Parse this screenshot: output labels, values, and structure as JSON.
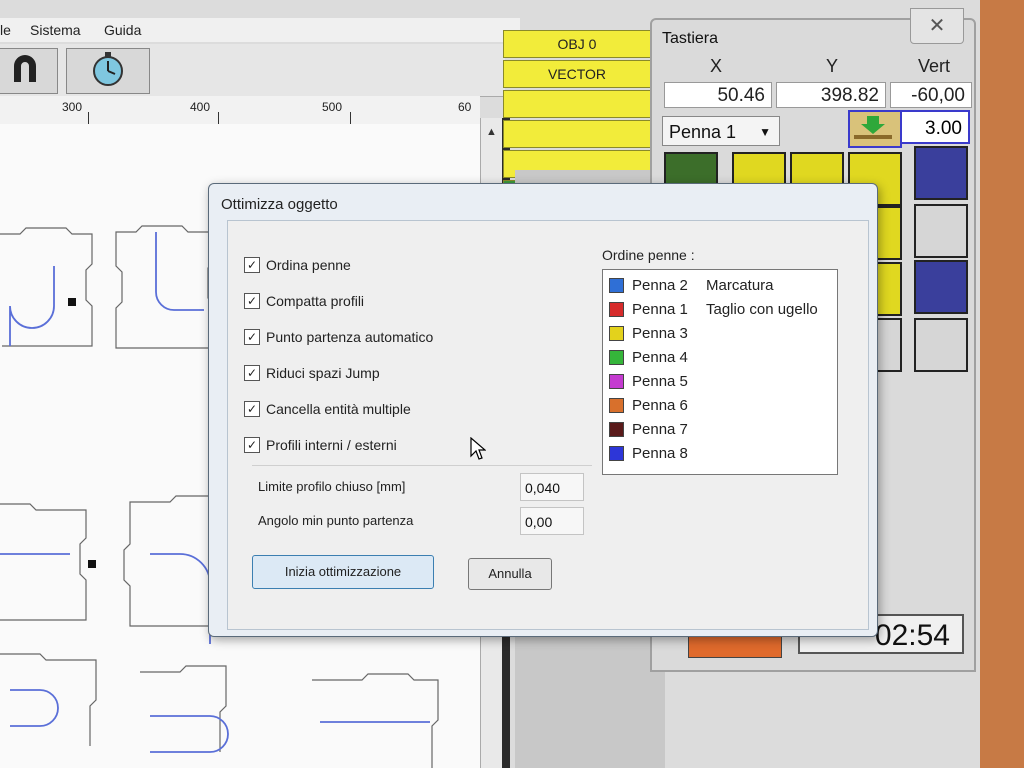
{
  "menu": {
    "items": [
      "le",
      "Sistema",
      "Guida"
    ]
  },
  "ruler": {
    "labels": [
      "300",
      "400",
      "500",
      "60"
    ]
  },
  "layers": {
    "items": [
      "OBJ 0",
      "VECTOR",
      "",
      "",
      "",
      ""
    ]
  },
  "tastiera": {
    "title": "Tastiera",
    "close": "✕",
    "axes": [
      {
        "label": "X",
        "value": "50.46"
      },
      {
        "label": "Y",
        "value": "398.82"
      },
      {
        "label": "Vert",
        "value": "-60,00"
      }
    ],
    "pen": "Penna 1",
    "step": "3.00",
    "timer": "02:54"
  },
  "dialog": {
    "title": "Ottimizza oggetto",
    "options": [
      {
        "label": "Ordina penne",
        "checked": true
      },
      {
        "label": "Compatta profili",
        "checked": true
      },
      {
        "label": "Punto partenza automatico",
        "checked": true
      },
      {
        "label": "Riduci spazi Jump",
        "checked": true
      },
      {
        "label": "Cancella entità multiple",
        "checked": true
      },
      {
        "label": "Profili interni / esterni",
        "checked": true
      }
    ],
    "fields": [
      {
        "label": "Limite profilo chiuso [mm]",
        "value": "0,040"
      },
      {
        "label": "Angolo min punto partenza",
        "value": "0,00"
      }
    ],
    "start_button": "Inizia ottimizzazione",
    "cancel_button": "Annulla",
    "pens_title": "Ordine penne :",
    "pens": [
      {
        "name": "Penna 2",
        "desc": "Marcatura",
        "color": "#2f6fd6"
      },
      {
        "name": "Penna 1",
        "desc": "Taglio con ugello",
        "color": "#d62b2b"
      },
      {
        "name": "Penna 3",
        "desc": "",
        "color": "#e3d21c"
      },
      {
        "name": "Penna 4",
        "desc": "",
        "color": "#35b53a"
      },
      {
        "name": "Penna 5",
        "desc": "",
        "color": "#c43bd0"
      },
      {
        "name": "Penna 6",
        "desc": "",
        "color": "#d8702c"
      },
      {
        "name": "Penna 7",
        "desc": "",
        "color": "#5a1a1a"
      },
      {
        "name": "Penna 8",
        "desc": "",
        "color": "#2d36d8"
      }
    ]
  }
}
